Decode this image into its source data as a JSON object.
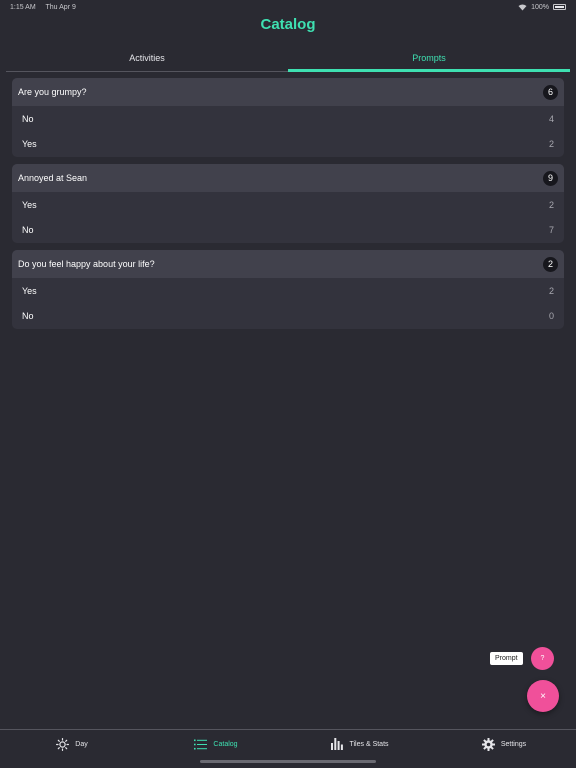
{
  "status_bar": {
    "time": "1:15 AM",
    "date": "Thu Apr 9",
    "battery": "100%"
  },
  "title": "Catalog",
  "tabs": [
    {
      "label": "Activities",
      "active": false
    },
    {
      "label": "Prompts",
      "active": true
    }
  ],
  "cards": [
    {
      "question": "Are you grumpy?",
      "count": "6",
      "answers": [
        {
          "label": "No",
          "value": "4"
        },
        {
          "label": "Yes",
          "value": "2"
        }
      ]
    },
    {
      "question": "Annoyed at Sean",
      "count": "9",
      "answers": [
        {
          "label": "Yes",
          "value": "2"
        },
        {
          "label": "No",
          "value": "7"
        }
      ]
    },
    {
      "question": "Do you feel happy about your life?",
      "count": "2",
      "answers": [
        {
          "label": "Yes",
          "value": "2"
        },
        {
          "label": "No",
          "value": "0"
        }
      ]
    }
  ],
  "fab": {
    "prompt_label": "Prompt",
    "small_icon": "?",
    "big_icon": "×"
  },
  "nav": [
    {
      "label": "Day",
      "icon": "sun-icon"
    },
    {
      "label": "Catalog",
      "icon": "list-icon",
      "active": true
    },
    {
      "label": "Tiles & Stats",
      "icon": "bar-chart-icon"
    },
    {
      "label": "Settings",
      "icon": "gear-icon"
    }
  ],
  "colors": {
    "accent": "#3ee0b1",
    "background": "#2a2a32",
    "fab": "#f0509a"
  }
}
